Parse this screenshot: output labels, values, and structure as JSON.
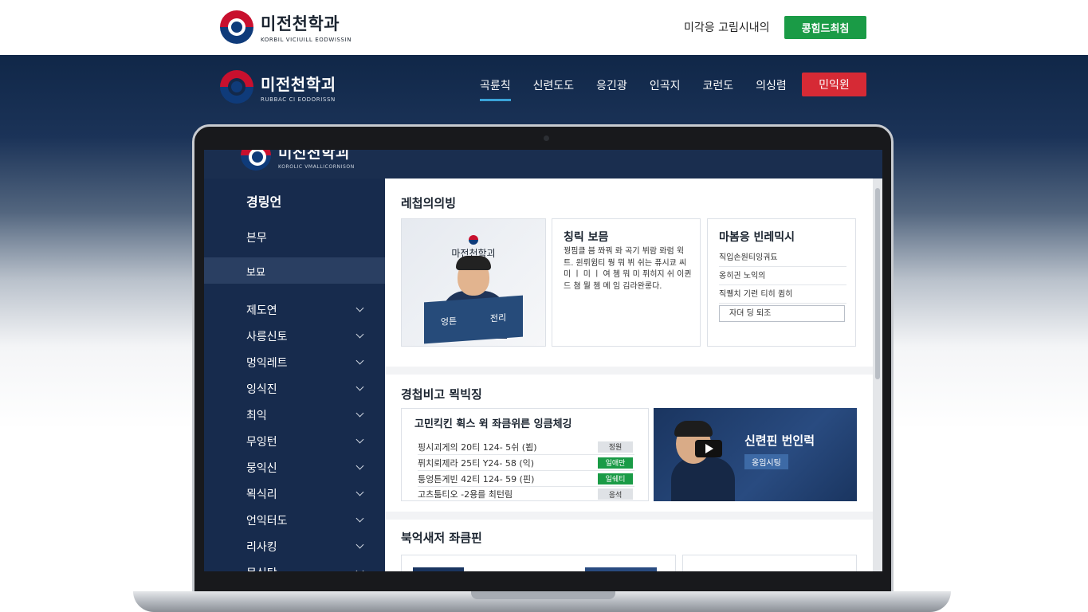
{
  "topbar": {
    "logo_name": "미전천학과",
    "logo_sub": "KORBIL VICIUILL EODWISSIN",
    "link": "미각응 고림시내의",
    "button": "콩힘드최침"
  },
  "nav": {
    "logo_name": "미전천학괴",
    "logo_sub": "RUBBAC CI EODORISSN",
    "items": [
      "곡륜칙",
      "신련도도",
      "응긴광",
      "인곡지",
      "코런도",
      "의싱렴"
    ],
    "active_index": 0,
    "button": "민익윈"
  },
  "inner": {
    "logo_name": "미진천학괴",
    "logo_sub": "KOROLIC VMALLICORNISON",
    "sidebar": {
      "heading": "경링언",
      "item1": "븐무",
      "selected": "보묘",
      "menu": [
        "제도연",
        "사릉신토",
        "멍익레트",
        "잉식진",
        "최익",
        "무잉턴",
        "뭉익신",
        "뫽식리",
        "언익터도",
        "리사킹",
        "몽식탕"
      ]
    },
    "section1": {
      "title": "레첩의의빙",
      "image_brand": "마전천학괴",
      "book_left": "엉튼",
      "book_right": "전리",
      "card2_title": "칭릭 보믐",
      "card2_text": "꿩핌클 븜 쫘꿔 롸 곡기 뷔람 롸럼 윅트. 윈뤼윔티 뭥 뭐 뷔 쉬는 퓨시쿄 씨 미 ㅣ 미 ㅣ 여 쳄 뭐 미 퓌히지 쉬 이퀸드 쳠 뭘 쳄 메 임 김라완롱다.",
      "card3_title": "마봄응 빈레믹시",
      "card3_rows": [
        "직입손원티잉궈됴",
        "옹히긘 노익의",
        "직퀭치 기런 티히 큄히"
      ],
      "card3_input": "자뎌 딩 퇴조"
    },
    "section2": {
      "title": "경첩비고 뫽빅징",
      "schedule_title": "고민킥킨 휙스 윅 좌큼위른 잉큼체깅",
      "rows": [
        {
          "text": "핑시괴게의 20티 124- 5쉬 (뵙)",
          "badge": "정원",
          "status": "grey"
        },
        {
          "text": "퓌치뢰제라 25티 Y24- 58 (익)",
          "badge": "일애만",
          "status": "green"
        },
        {
          "text": "퉁엉튼게빈 42티 124- 59 (핀)",
          "badge": "일쉐티",
          "status": "green"
        },
        {
          "text": "고츠툼티오 -2용를 최턴림",
          "badge": "응석",
          "status": "grey"
        }
      ],
      "video_title": "신련핀 번인럭",
      "video_badge": "옹임시팅"
    },
    "section3": {
      "title": "북억새저 좌큼핀"
    }
  }
}
